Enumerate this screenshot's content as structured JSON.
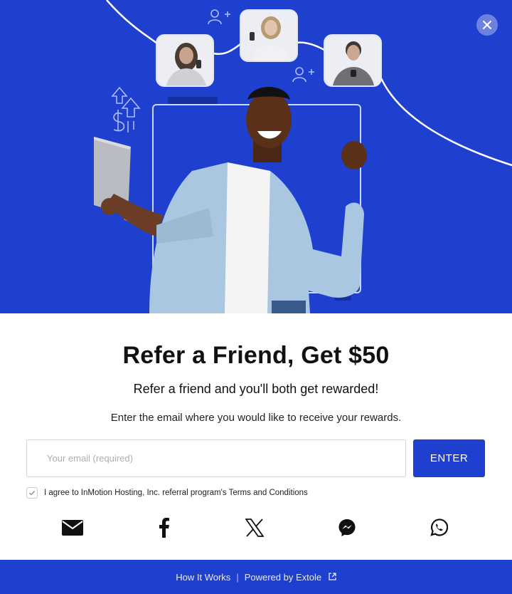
{
  "hero": {
    "close_icon": "close-icon",
    "avatars": [
      "woman-with-phone-avatar",
      "woman-on-phone-avatar",
      "man-with-phone-avatar"
    ],
    "decor_icons": [
      "add-user-icon",
      "dollar-arrows-icon"
    ],
    "background_color": "#1f3fcf"
  },
  "main": {
    "title": "Refer a Friend, Get $50",
    "subtitle": "Refer a friend and you'll both get rewarded!",
    "instruction": "Enter the email where you would like to receive your rewards.",
    "email_placeholder": "Your email (required)",
    "email_value": "",
    "enter_label": "ENTER",
    "agree_text": "I agree to InMotion Hosting, Inc. referral program's Terms and Conditions",
    "agree_checked": true,
    "share_icons": [
      "email-icon",
      "facebook-icon",
      "x-icon",
      "messenger-icon",
      "whatsapp-icon"
    ]
  },
  "footer": {
    "how_it_works": "How It Works",
    "separator": "|",
    "powered_by": "Powered by Extole",
    "external_icon": "external-link-icon"
  },
  "colors": {
    "accent": "#1f3fcf",
    "text": "#111111",
    "white": "#ffffff"
  }
}
